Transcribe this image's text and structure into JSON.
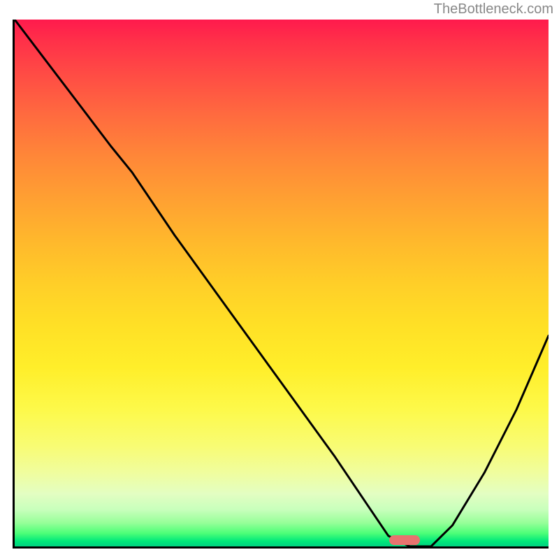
{
  "watermark": "TheBottleneck.com",
  "chart_data": {
    "type": "line",
    "title": "",
    "xlabel": "",
    "ylabel": "",
    "xlim": [
      0,
      100
    ],
    "ylim": [
      0,
      100
    ],
    "grid": false,
    "series": [
      {
        "name": "curve",
        "x": [
          0,
          6,
          12,
          18,
          22,
          30,
          40,
          50,
          60,
          66,
          70,
          74,
          78,
          82,
          88,
          94,
          100
        ],
        "y": [
          100,
          92,
          84,
          76,
          71,
          59,
          45,
          31,
          17,
          8,
          2,
          0,
          0,
          4,
          14,
          26,
          40
        ]
      }
    ],
    "background_gradient": {
      "top": "#ff1a4d",
      "mid": "#ffd428",
      "bottom": "#00d280"
    },
    "marker": {
      "x_center_pct": 73,
      "width_pct": 5.8,
      "color": "#e8736f"
    }
  }
}
